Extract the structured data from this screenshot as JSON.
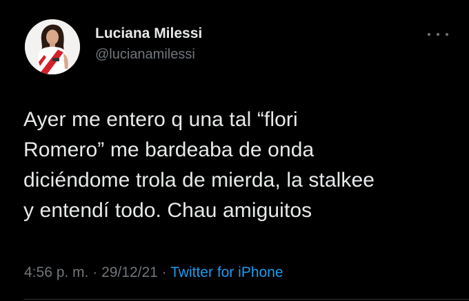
{
  "tweet": {
    "author": {
      "display_name": "Luciana Milessi",
      "handle": "@lucianamilessi"
    },
    "more_icon": "more-dots-icon",
    "text_lines": [
      "Ayer me entero q una tal “flori",
      "Romero” me bardeaba de onda",
      "diciéndome trola de mierda, la stalkee",
      "y entendí todo. Chau amiguitos"
    ],
    "time": "4:56 p. m.",
    "separator": "·",
    "date": "29/12/21",
    "source": "Twitter for iPhone"
  },
  "colors": {
    "background": "#000000",
    "primary_text": "#e7e9ea",
    "secondary_text": "#71767b",
    "link": "#1d9bf0"
  }
}
